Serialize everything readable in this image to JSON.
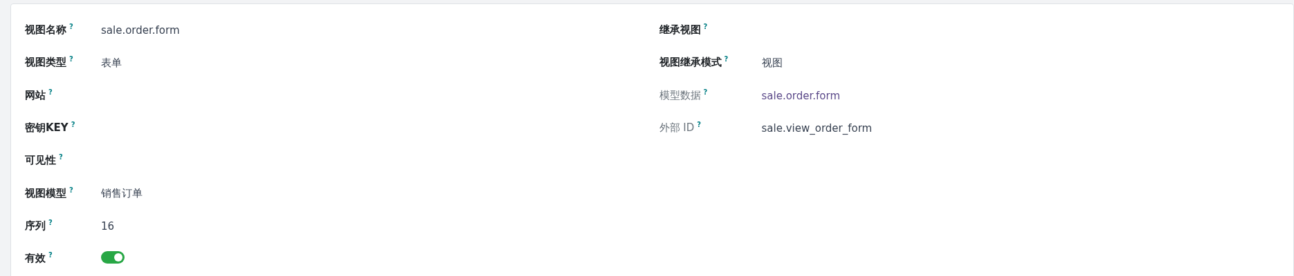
{
  "left_fields": [
    {
      "label": "视图名称",
      "help": "?",
      "kind": "text",
      "value": "sale.order.form"
    },
    {
      "label": "视图类型",
      "help": "?",
      "kind": "text",
      "value": "表单"
    },
    {
      "label": "网站",
      "help": "?",
      "kind": "text"
    },
    {
      "label": "密钥KEY",
      "help": "?",
      "kind": "text"
    },
    {
      "label": "可见性",
      "help": "?",
      "kind": "text"
    },
    {
      "label": "视图模型",
      "help": "?",
      "kind": "text",
      "value": "销售订单"
    },
    {
      "label": "序列",
      "help": "?",
      "kind": "text",
      "value": "16"
    },
    {
      "label": "有效",
      "help": "?",
      "kind": "toggle",
      "on": true
    }
  ],
  "right_fields": [
    {
      "label": "继承视图",
      "help": "?",
      "kind": "text",
      "readonly": false
    },
    {
      "label": "视图继承模式",
      "help": "?",
      "kind": "text",
      "readonly": false,
      "value": "视图"
    },
    {
      "label": "模型数据",
      "help": "?",
      "kind": "link",
      "readonly": true,
      "value": "sale.order.form"
    },
    {
      "label": "外部 ID",
      "help": "?",
      "kind": "text",
      "readonly": true,
      "value": "sale.view_order_form"
    }
  ]
}
